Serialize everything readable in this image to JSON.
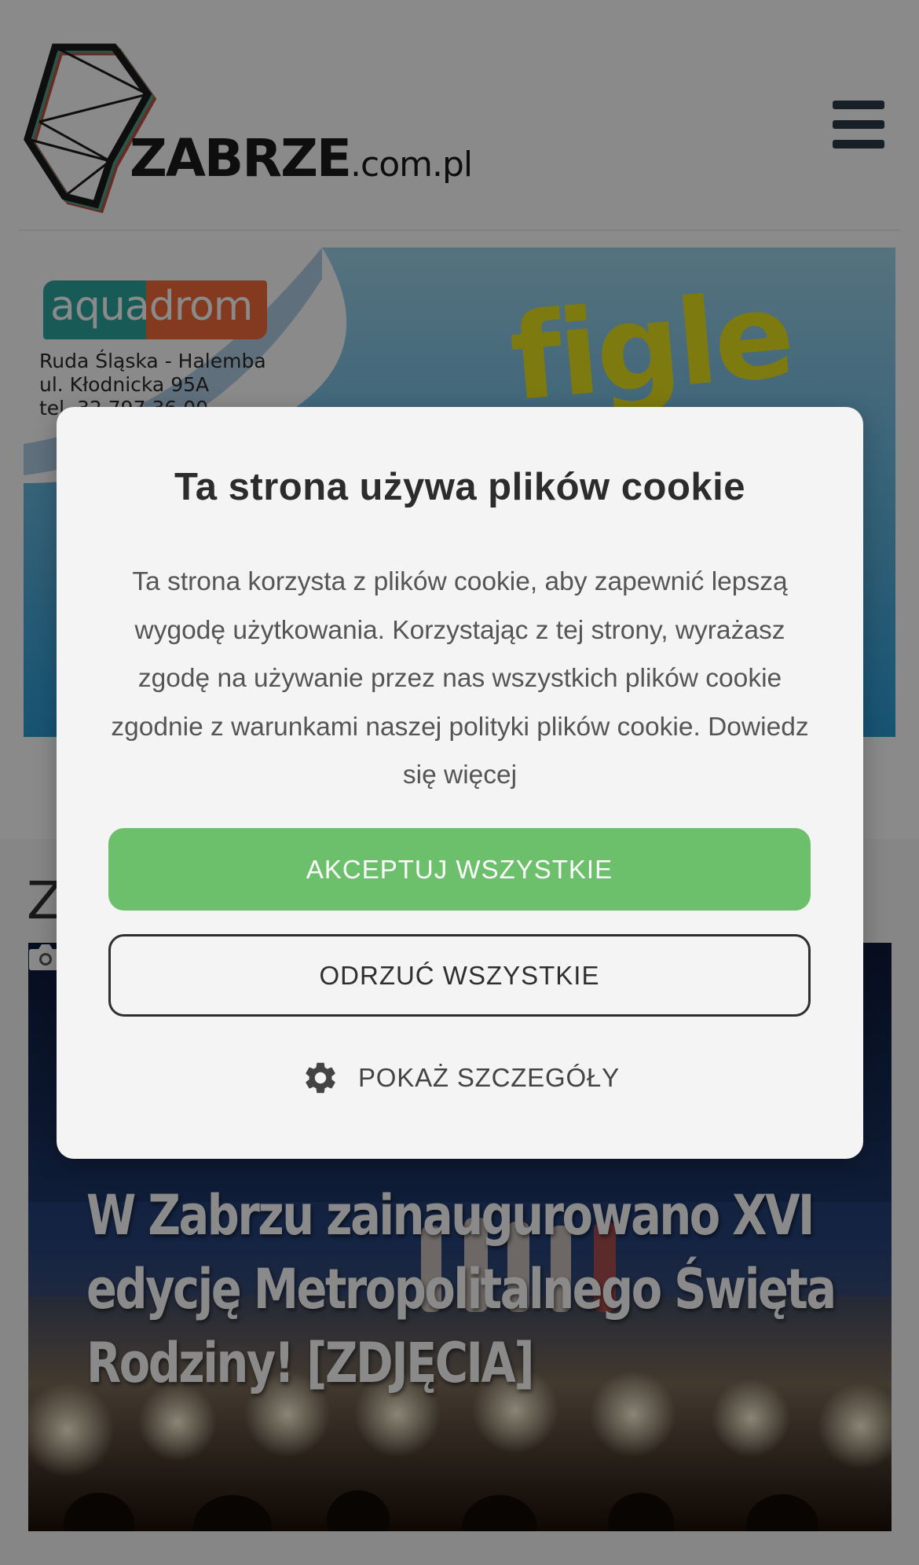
{
  "header": {
    "logo_main": "ZABRZE",
    "logo_sub": ".com.pl",
    "menu_icon": "hamburger-menu-icon"
  },
  "ad": {
    "brand": "aquadrom",
    "address_lines": [
      "Ruda Śląska - Halemba",
      "ul. Kłodnicka 95A",
      "tel. 32 797 36 00"
    ],
    "headline": "figle"
  },
  "section": {
    "heading": "Z"
  },
  "article": {
    "title": "W Zabrzu zainaugurowano XVI edycję Metropolitalnego Święta Rodziny! [ZDJĘCIA]",
    "media_icon": "camera-icon"
  },
  "cookie": {
    "title": "Ta strona używa plików cookie",
    "body": "Ta strona korzysta z plików cookie, aby zapewnić lepszą wygodę użytkowania. Korzystając z tej strony, wyrażasz zgodę na używanie przez nas wszystkich plików cookie zgodnie z warunkami naszej polityki plików cookie.",
    "learn_more": "Dowiedz się więcej",
    "accept_label": "AKCEPTUJ WSZYSTKIE",
    "reject_label": "ODRZUĆ WSZYSTKIE",
    "details_label": "POKAŻ SZCZEGÓŁY",
    "details_icon": "gear-icon"
  },
  "colors": {
    "accept_green": "#6cc06c",
    "menu_dark": "#2b3a49",
    "overlay": "rgba(0,0,0,0.46)"
  }
}
